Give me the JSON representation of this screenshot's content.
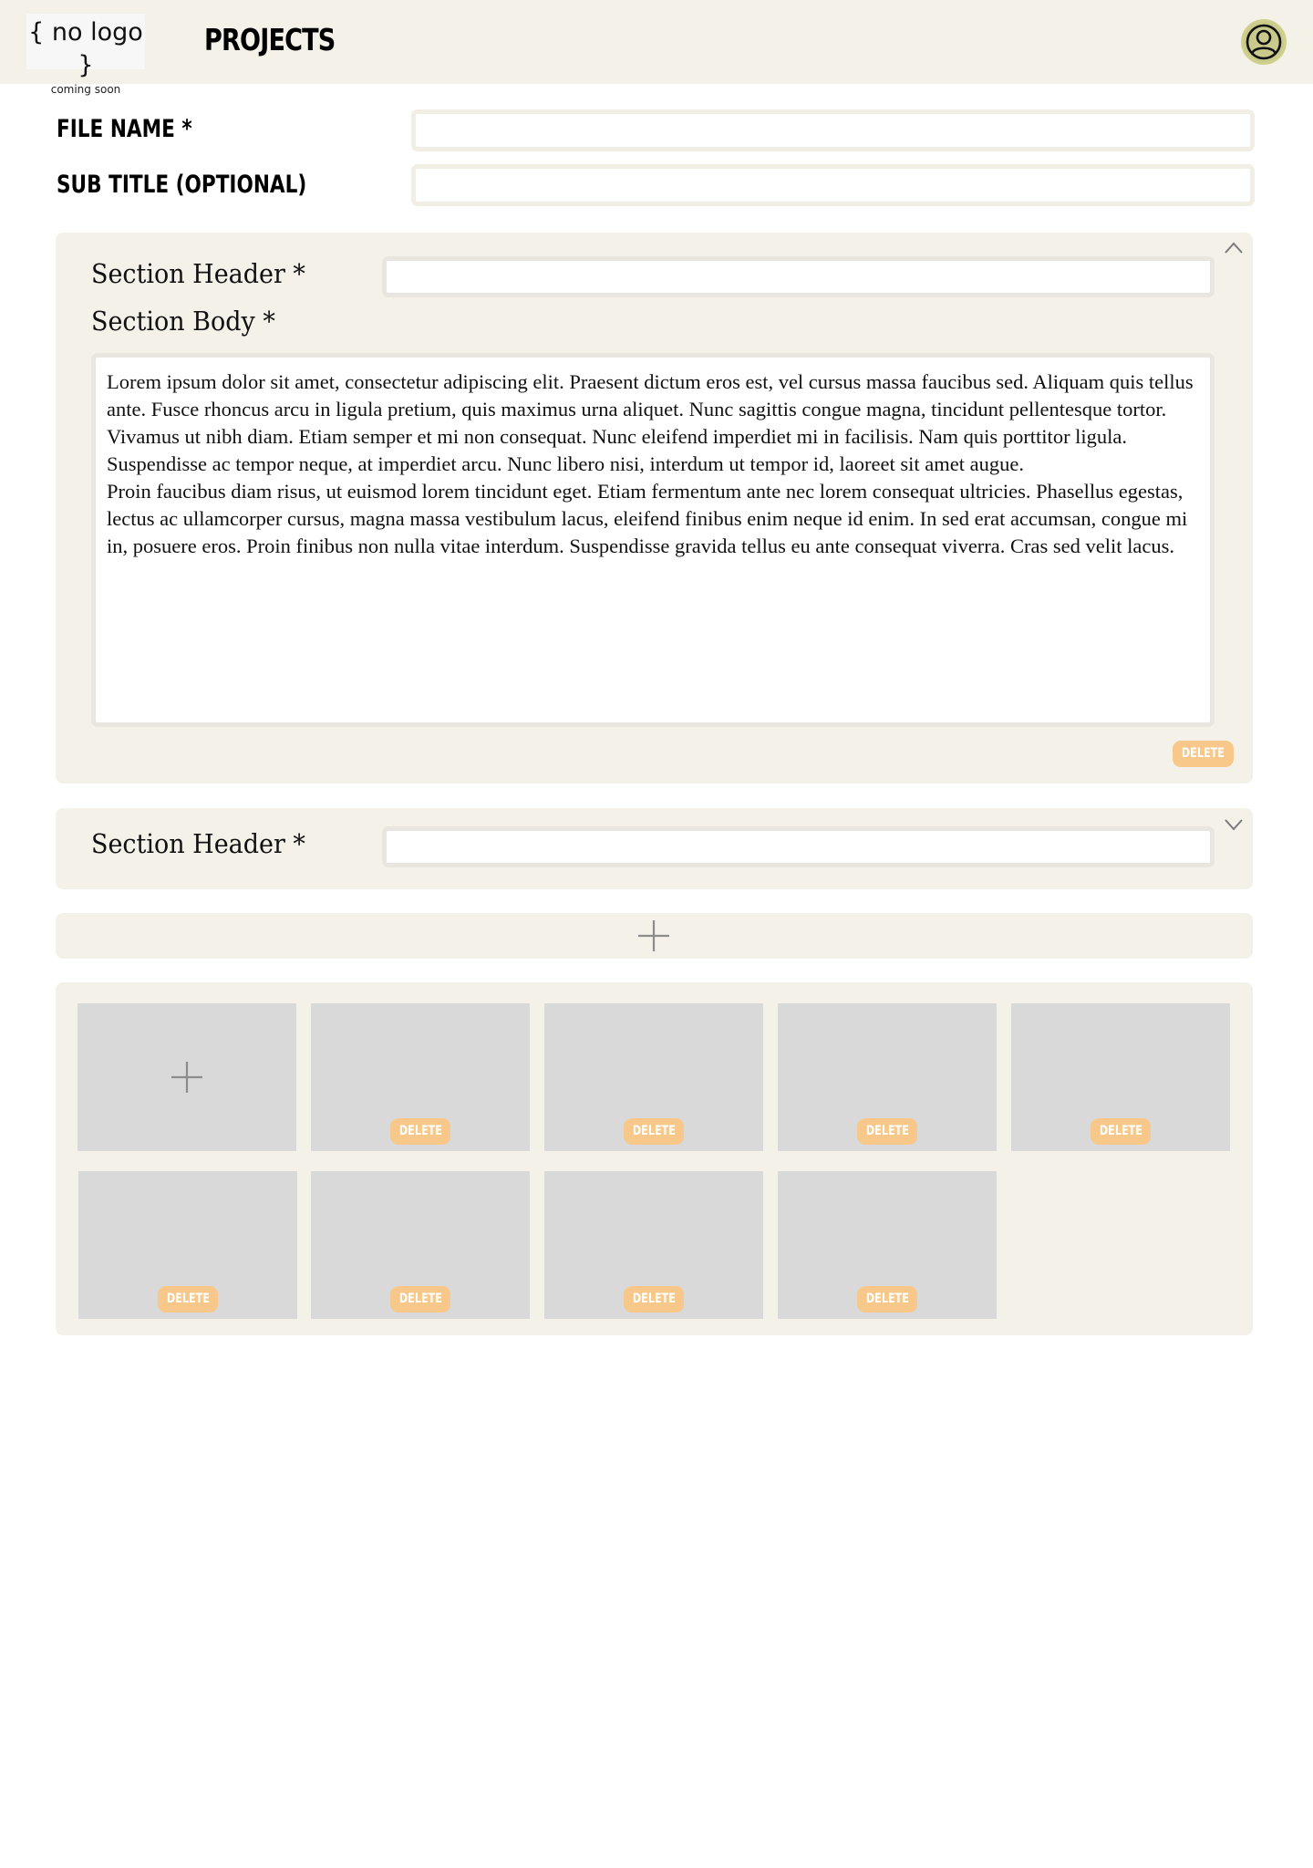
{
  "header": {
    "logo_main": "{ no logo }",
    "logo_sub": "coming soon",
    "title": "PROJECTS",
    "avatar_icon": "user-circle-icon"
  },
  "form": {
    "file_name_label": "FILE NAME *",
    "file_name_value": "",
    "subtitle_label": "SUB TITLE (OPTIONAL)",
    "subtitle_value": ""
  },
  "sections": [
    {
      "state": "expanded",
      "toggle_icon": "chevron-up-icon",
      "header_label": "Section Header *",
      "header_value": "",
      "body_label": "Section Body *",
      "body_text": "Lorem ipsum dolor sit amet, consectetur adipiscing elit. Praesent dictum eros est, vel cursus massa faucibus sed. Aliquam quis tellus ante. Fusce rhoncus arcu in ligula pretium, quis maximus urna aliquet. Nunc sagittis congue magna, tincidunt pellentesque tortor. Vivamus ut nibh diam. Etiam semper et mi non consequat. Nunc eleifend imperdiet mi in facilisis. Nam quis porttitor ligula. Suspendisse ac tempor neque, at imperdiet arcu. Nunc libero nisi, interdum ut tempor id, laoreet sit amet augue.\nProin faucibus diam risus, ut euismod lorem tincidunt eget. Etiam fermentum ante nec lorem consequat ultricies. Phasellus egestas, lectus ac ullamcorper cursus, magna massa vestibulum lacus, eleifend finibus enim neque id enim. In sed erat accumsan, congue mi in, posuere eros. Proin finibus non nulla vitae interdum. Suspendisse gravida tellus eu ante consequat viverra. Cras sed velit lacus.",
      "delete_label": "DELETE"
    },
    {
      "state": "collapsed",
      "toggle_icon": "chevron-down-icon",
      "header_label": "Section Header *",
      "header_value": ""
    }
  ],
  "add_section_icon": "plus-icon",
  "gallery": {
    "add_icon": "plus-icon",
    "delete_label": "DELETE",
    "image_count": 8
  },
  "colors": {
    "panel_bg": "#f4f1e9",
    "tile_bg": "#d9d9d9",
    "delete_bg": "#f7c889",
    "avatar_bg": "#c8c98a"
  }
}
